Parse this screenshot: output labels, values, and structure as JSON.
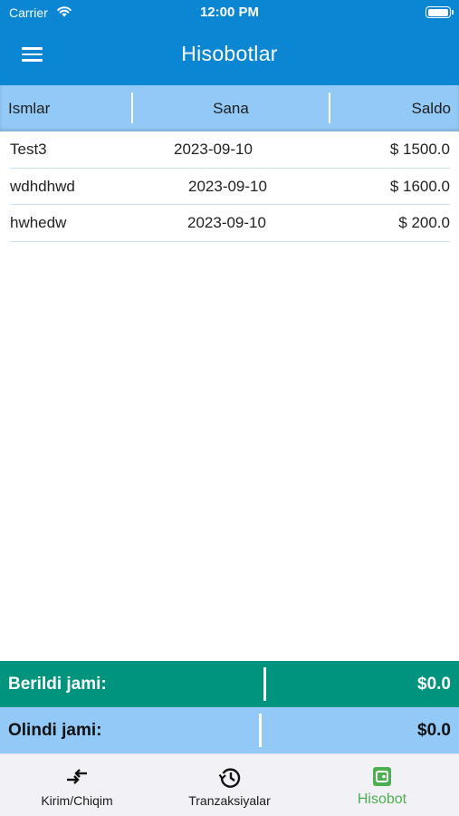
{
  "status_bar": {
    "carrier": "Carrier",
    "time": "12:00 PM"
  },
  "header": {
    "title": "Hisobotlar",
    "menu_icon": "menu-icon"
  },
  "table": {
    "columns": [
      "Ismlar",
      "Sana",
      "Saldo"
    ],
    "rows": [
      {
        "name": "Test3",
        "date": "2023-09-10",
        "amount": "$ 1500.0"
      },
      {
        "name": "wdhdhwd",
        "date": "2023-09-10",
        "amount": "$ 1600.0"
      },
      {
        "name": "hwhedw",
        "date": "2023-09-10",
        "amount": "$ 200.0"
      }
    ]
  },
  "totals": {
    "given": {
      "label": "Berildi jami:",
      "value": "$0.0",
      "color": "#00947e"
    },
    "received": {
      "label": "Olindi jami:",
      "value": "$0.0",
      "color": "#93c9f6"
    }
  },
  "tabs": [
    {
      "label": "Kirim/Chiqim",
      "icon": "swap-arrows-icon",
      "active": false
    },
    {
      "label": "Tranzaksiyalar",
      "icon": "history-icon",
      "active": false
    },
    {
      "label": "Hisobot",
      "icon": "wallet-icon",
      "active": true
    }
  ],
  "colors": {
    "app_bar": "#0b86d2",
    "table_header": "#93c9f6",
    "active_tab": "#4caf50"
  }
}
